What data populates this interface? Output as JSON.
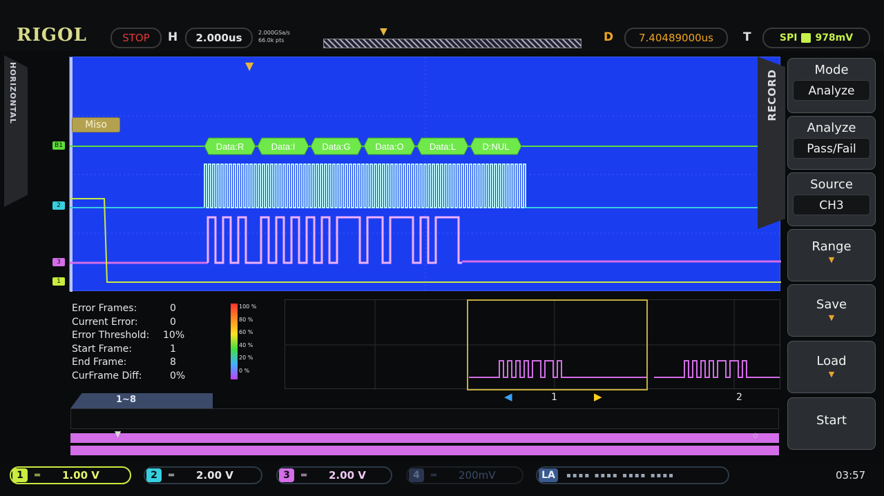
{
  "topbar": {
    "brand": "RIGOL",
    "run_state": "STOP",
    "h_label": "H",
    "timebase": "2.000us",
    "sample_rate": "2.000GSa/s",
    "mem_depth": "66.0k pts",
    "d_label": "D",
    "delay": "7.40489000us",
    "t_label": "T",
    "trigger_type": "SPI",
    "trigger_level": "978mV"
  },
  "left_tab": {
    "label": "HORIZONTAL"
  },
  "waveform": {
    "bus_label": "Miso",
    "decode_frames": [
      "Data:R",
      "Data:I",
      "Data:G",
      "Data:O",
      "Data:L",
      "D:NUL"
    ],
    "channel_colors": {
      "ch1": "#c9ec3e",
      "ch2": "#36d0e0",
      "ch3": "#d36ee8",
      "bus": "#5ddc3a"
    }
  },
  "record_panel": {
    "tab_label": "RECORD",
    "mode_title": "Mode",
    "mode_value": "Analyze",
    "analyze_title": "Analyze",
    "analyze_value": "Pass/Fail",
    "source_title": "Source",
    "source_value": "CH3",
    "range_label": "Range",
    "save_label": "Save",
    "load_label": "Load",
    "start_label": "Start"
  },
  "stats": {
    "rows": [
      {
        "label": "Error Frames:",
        "value": "0"
      },
      {
        "label": "Current Error:",
        "value": "0"
      },
      {
        "label": "Error Threshold:",
        "value": "10%"
      },
      {
        "label": "Start Frame:",
        "value": "1"
      },
      {
        "label": "End Frame:",
        "value": "8"
      },
      {
        "label": "CurFrame Diff:",
        "value": "0%"
      }
    ],
    "scale": [
      "100 %",
      "80 %",
      "60 %",
      "40 %",
      "20 %",
      "0 %"
    ]
  },
  "frames": {
    "frame1": "1",
    "frame2": "2",
    "range": "1~8"
  },
  "bottombar": {
    "ch1_num": "1",
    "ch1_coupling": "═",
    "ch1_scale": "1.00 V",
    "ch2_num": "2",
    "ch2_coupling": "═",
    "ch2_scale": "2.00 V",
    "ch3_num": "3",
    "ch3_coupling": "═",
    "ch3_scale": "2.00 V",
    "ch4_num": "4",
    "ch4_coupling": "═",
    "ch4_scale": "200mV",
    "la_label": "LA",
    "time": "03:57"
  }
}
